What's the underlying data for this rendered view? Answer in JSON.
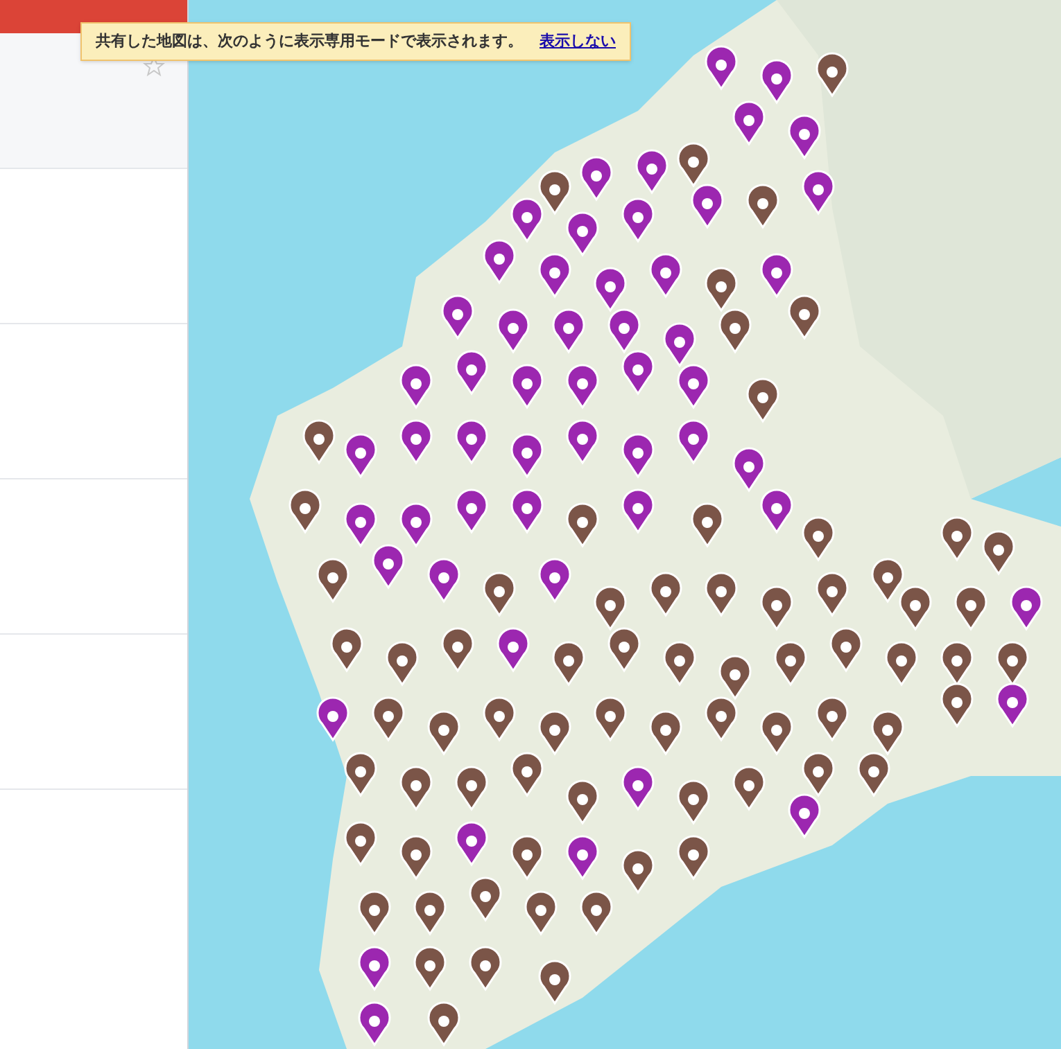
{
  "notice": {
    "text": "共有した地図は、次のように表示専用モードで表示されます。",
    "link": "表示しない"
  },
  "panel": {
    "starred": false
  }
}
